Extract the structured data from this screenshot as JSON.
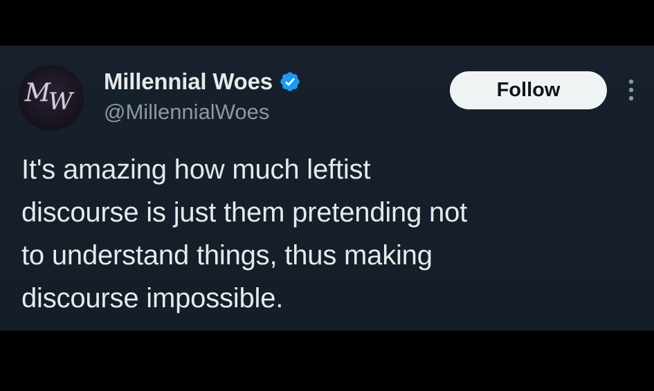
{
  "author": {
    "display_name": "Millennial Woes",
    "handle": "@MillennialWoes",
    "avatar_text": "MW",
    "verified": true
  },
  "actions": {
    "follow_label": "Follow",
    "more_icon": "more-vertical-icon"
  },
  "tweet": {
    "lines": [
      "It's amazing how much leftist",
      "discourse is just them pretending not",
      "to understand things, thus making",
      "discourse impossible."
    ]
  },
  "colors": {
    "background": "#000000",
    "card": "#15202b",
    "text_primary": "#e7e9ea",
    "text_secondary": "#8b98a5",
    "verified_badge": "#1d9bf0",
    "follow_button_bg": "#eff3f4",
    "follow_button_text": "#0f1419"
  }
}
